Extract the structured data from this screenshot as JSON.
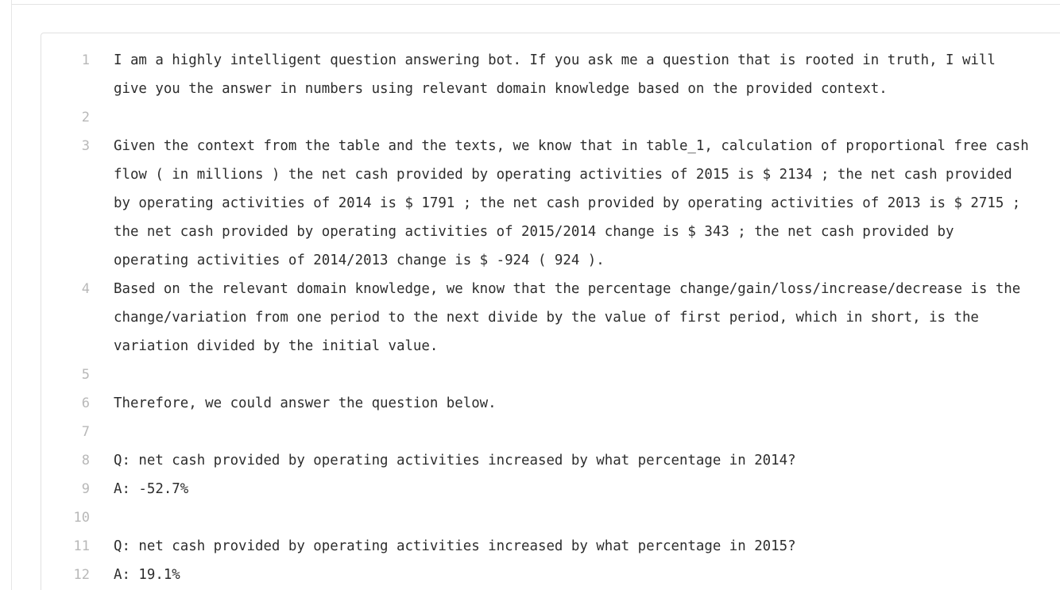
{
  "editor": {
    "lines": [
      {
        "number": "1",
        "text": "I am a highly intelligent question answering bot. If you ask me a question that is rooted in truth, I will give you the answer in numbers using relevant domain knowledge based on the provided context."
      },
      {
        "number": "2",
        "text": ""
      },
      {
        "number": "3",
        "text": "Given the context from the table and the texts, we know that in table_1, calculation of proportional free cash flow ( in millions ) the net cash provided by operating activities of 2015 is $ 2134 ; the net cash provided by operating activities of 2014 is $ 1791 ; the net cash provided by operating activities of 2013 is $ 2715 ; the net cash provided by operating activities of 2015/2014 change is $ 343 ; the net cash provided by operating activities of 2014/2013 change is $ -924 ( 924 )."
      },
      {
        "number": "4",
        "text": "Based on the relevant domain knowledge, we know that the percentage change/gain/loss/increase/decrease is the change/variation from one period to the next divide by the value of first period, which in short, is the variation divided by the initial value."
      },
      {
        "number": "5",
        "text": ""
      },
      {
        "number": "6",
        "text": "Therefore, we could answer the question below."
      },
      {
        "number": "7",
        "text": ""
      },
      {
        "number": "8",
        "text": "Q: net cash provided by operating activities increased by what percentage in 2014?"
      },
      {
        "number": "9",
        "text": "A: -52.7%"
      },
      {
        "number": "10",
        "text": ""
      },
      {
        "number": "11",
        "text": "Q: net cash provided by operating activities increased by what percentage in 2015?"
      },
      {
        "number": "12",
        "text": "A: 19.1%"
      }
    ]
  }
}
